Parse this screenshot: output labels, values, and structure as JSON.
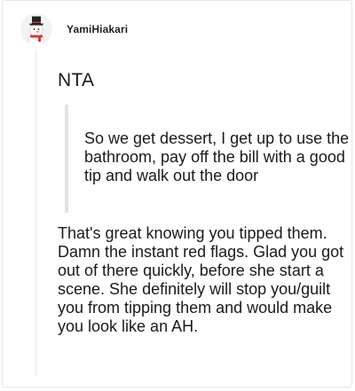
{
  "post": {
    "username": "YamiHiakari",
    "reply_heading": "NTA",
    "quote": "So we get dessert, I get up to use the bathroom, pay off the bill with a good tip and walk out the door",
    "reply_body": "That's great knowing you tipped them. Damn the instant red flags. Glad you got out of there quickly, before she start a scene. She definitely will stop you/guilt you from tipping them and would make you look like an AH."
  },
  "colors": {
    "quote_bar": "#e3e3e3",
    "card_border": "#e6e6e6",
    "text": "#1a1a1a"
  },
  "icons": {
    "avatar": "snowman-avatar-icon"
  }
}
